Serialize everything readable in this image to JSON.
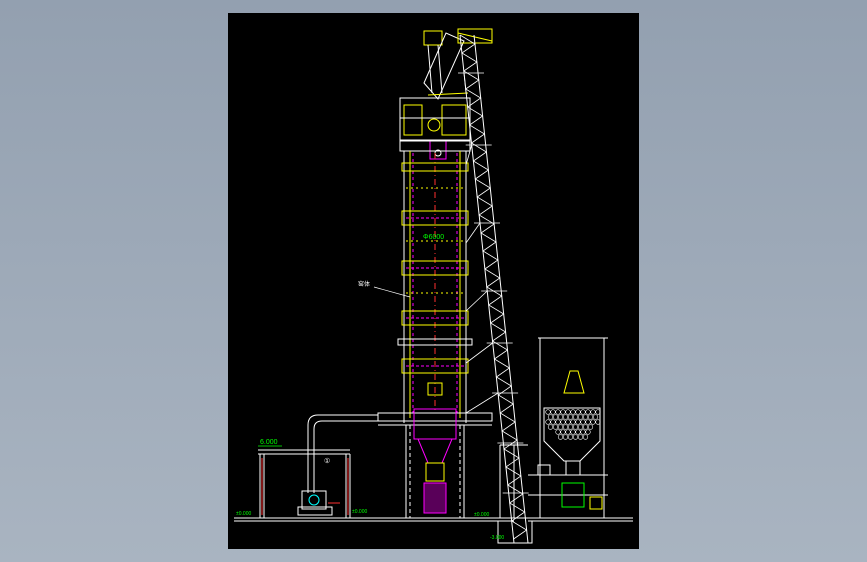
{
  "drawing": {
    "label_upper_diameter": "Φ6000",
    "label_side_note": "窑体",
    "label_elevation_left": "6.000",
    "label_ground_left": "±0.000",
    "label_ground_mid": "±0.000",
    "label_ground_mid2": "±0.000",
    "label_pit": "-3.000",
    "label_pipe_mark": "①"
  },
  "colors": {
    "background": "#000000",
    "structure": "#ffffff",
    "kiln": "#ffff00",
    "accent": "#ff00ff",
    "ducts": "#00ff00",
    "cyan": "#00ffff",
    "red": "#ff3030"
  }
}
